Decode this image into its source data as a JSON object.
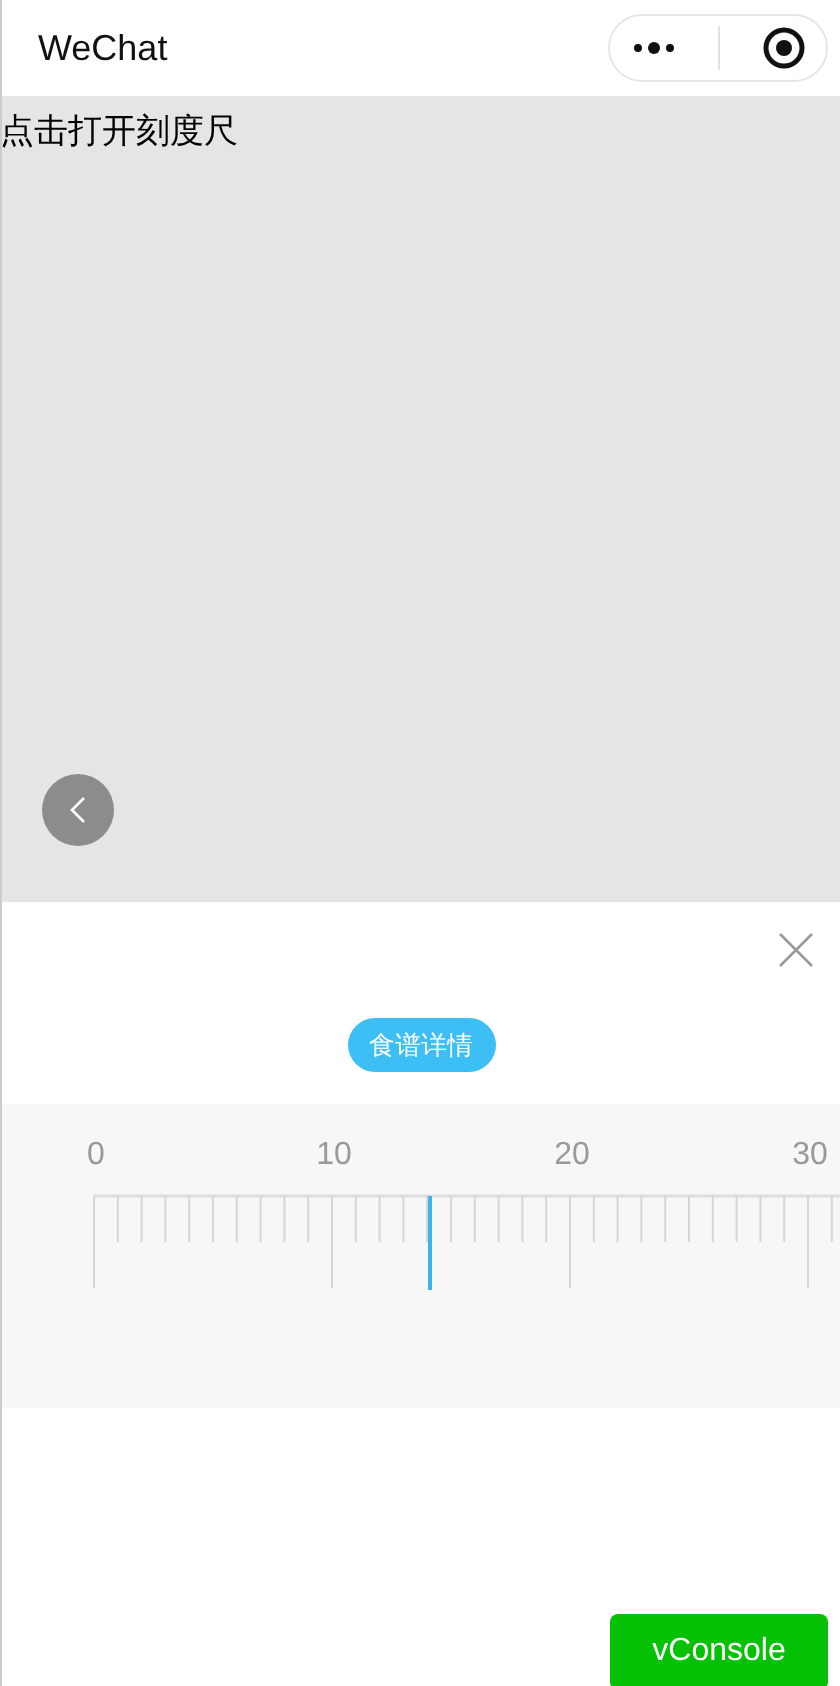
{
  "nav_bar": {
    "title": "WeChat"
  },
  "content": {
    "text": "点击打开刻度尺"
  },
  "panel": {
    "tag": "食谱详情"
  },
  "ruler": {
    "labels": [
      "0",
      "10",
      "20",
      "30"
    ],
    "level": 0.467
  },
  "console_button": {
    "label": "vConsole"
  }
}
